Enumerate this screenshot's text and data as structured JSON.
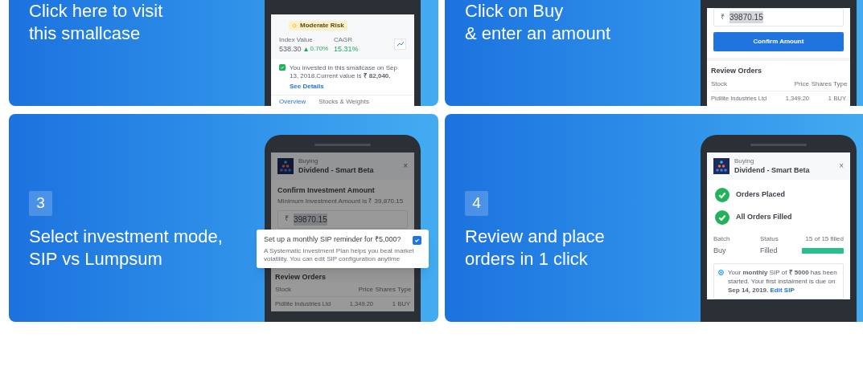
{
  "cards": [
    {
      "title": [
        "Click here to visit",
        "this smallcase"
      ],
      "phone": {
        "kind": "overview",
        "risk": "Moderate Risk",
        "stats": [
          {
            "label": "Index Value",
            "value": "538.30",
            "change": "0.70%"
          },
          {
            "label": "CAGR",
            "value": "15.31%"
          }
        ],
        "notice": "You invested in this smallcase on Sep 13, 2018.Current value is **₹ 82,040.**",
        "link": "See Details",
        "tabs": [
          {
            "label": "Overview",
            "selected": true
          },
          {
            "label": "Stocks & Weights",
            "selected": false
          }
        ]
      }
    },
    {
      "title": [
        "Click on Buy",
        "& enter an amount"
      ],
      "phone": {
        "kind": "amount",
        "currency": "₹",
        "amount": "39870.15",
        "button": "Confirm Amount",
        "orders": {
          "title": "Review Orders",
          "columns": [
            "Stock",
            "Price",
            "Shares",
            "Type"
          ],
          "rows": [
            [
              "Pidilite Industries Ltd",
              "1,349.20",
              "1",
              "BUY"
            ]
          ]
        }
      }
    },
    {
      "step": "3",
      "title": [
        "Select investment mode,",
        "SIP vs Lumpsum"
      ],
      "phone": {
        "kind": "sip",
        "label": "Buying",
        "name": "Dividend - Smart Beta",
        "close": "×",
        "section": "Confirm Investment Amount",
        "hint": "Minimum Investment Amount is ₹ 39,870.15",
        "currency": "₹",
        "amount": "39870.15",
        "popup": {
          "title": "Set up a monthly SIP reminder for ₹5,000?",
          "checked": true,
          "text": "A Systematic Investment Plan helps you beat market volatility. You can edit SIP configuration anytime"
        },
        "orders": {
          "title": "Review Orders",
          "columns": [
            "Stock",
            "Price",
            "Shares",
            "Type"
          ],
          "rows": [
            [
              "Pidilite Industries Ltd",
              "1,349.20",
              "1",
              "BUY"
            ]
          ]
        }
      }
    },
    {
      "step": "4",
      "title": [
        "Review and place",
        "orders in 1 click"
      ],
      "phone": {
        "kind": "done",
        "label": "Buying",
        "name": "Dividend - Smart Beta",
        "close": "×",
        "steps": [
          {
            "label": "Orders Placed",
            "done": true
          },
          {
            "label": "All Orders Filled",
            "done": true
          }
        ],
        "batch": {
          "columns": [
            "Batch",
            "Status",
            "15 of 15 filled"
          ],
          "values": [
            "Buy",
            "Filled"
          ],
          "level": 1
        },
        "notice": "Your **monthly** SIP of **₹ 5000** has been started. Your first instalment is due on **Sep 14, 2019.**",
        "link": "Edit SIP"
      }
    }
  ]
}
